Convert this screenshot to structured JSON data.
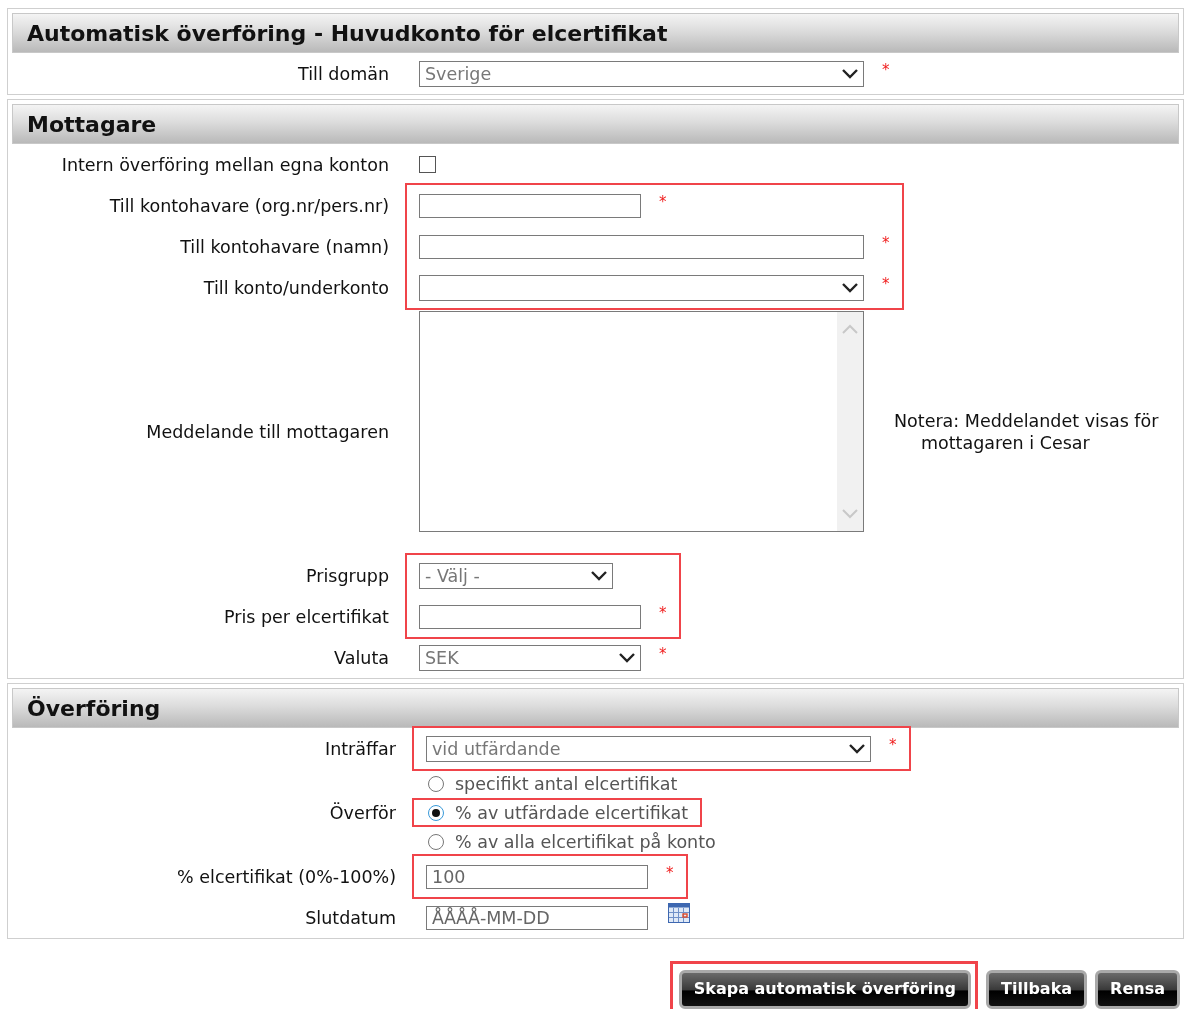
{
  "panels": [
    {
      "title": "Automatisk överföring - Huvudkonto för elcertifikat",
      "groups": [
        {
          "highlighted": false,
          "rows": [
            {
              "kind": "select",
              "label": "Till domän",
              "value": "Sverige",
              "marker": "*"
            }
          ]
        }
      ]
    },
    {
      "title": "Mottagare",
      "groups": [
        {
          "highlighted": false,
          "rows": [
            {
              "kind": "checkbox",
              "label": "Intern överföring mellan egna konton",
              "checked": false
            }
          ]
        },
        {
          "highlighted": true,
          "rows": [
            {
              "kind": "text",
              "label": "Till kontohavare (org.nr/pers.nr)",
              "marker": "*"
            },
            {
              "kind": "text",
              "label": "Till kontohavare (namn)",
              "marker": "*"
            },
            {
              "kind": "select",
              "label": "Till konto/underkonto",
              "marker": "*"
            }
          ]
        },
        {
          "highlighted": false,
          "rows": [
            {
              "kind": "textarea",
              "label": "Meddelande till mottagaren",
              "note": "Notera: Meddelandet visas för mottagaren i Cesar"
            }
          ]
        },
        {
          "highlighted": true,
          "rows": [
            {
              "kind": "select",
              "label": "Prisgrupp",
              "value": "- Välj -"
            },
            {
              "kind": "text",
              "label": "Pris per elcertifikat",
              "marker": "*"
            }
          ]
        },
        {
          "highlighted": false,
          "rows": [
            {
              "kind": "select",
              "label": "Valuta",
              "value": "SEK",
              "marker": "*"
            }
          ]
        }
      ]
    },
    {
      "title": "Överföring",
      "groups": [
        {
          "highlighted": true,
          "rows": [
            {
              "kind": "select",
              "label": "Inträffar",
              "value": "vid utfärdande",
              "marker": "*"
            }
          ]
        },
        {
          "highlighted": false,
          "rows": [
            {
              "kind": "radio",
              "label": "Överför",
              "options": [
                {
                  "label": "specifikt antal elcertifikat",
                  "selected": false,
                  "highlighted": false
                },
                {
                  "label": "% av utfärdade elcertifikat",
                  "selected": true,
                  "highlighted": true
                },
                {
                  "label": "% av alla elcertifikat på konto",
                  "selected": false,
                  "highlighted": false
                }
              ]
            }
          ]
        },
        {
          "highlighted": true,
          "rows": [
            {
              "kind": "text",
              "label": "% elcertifikat (0%-100%)",
              "value": "100",
              "marker": "*"
            }
          ]
        },
        {
          "highlighted": false,
          "rows": [
            {
              "kind": "date",
              "label": "Slutdatum",
              "placeholder": "ÅÅÅÅ-MM-DD"
            }
          ]
        }
      ]
    }
  ],
  "buttons": [
    {
      "label": "Skapa automatisk överföring",
      "highlighted": true
    },
    {
      "label": "Tillbaka",
      "highlighted": false
    },
    {
      "label": "Rensa",
      "highlighted": false
    }
  ]
}
